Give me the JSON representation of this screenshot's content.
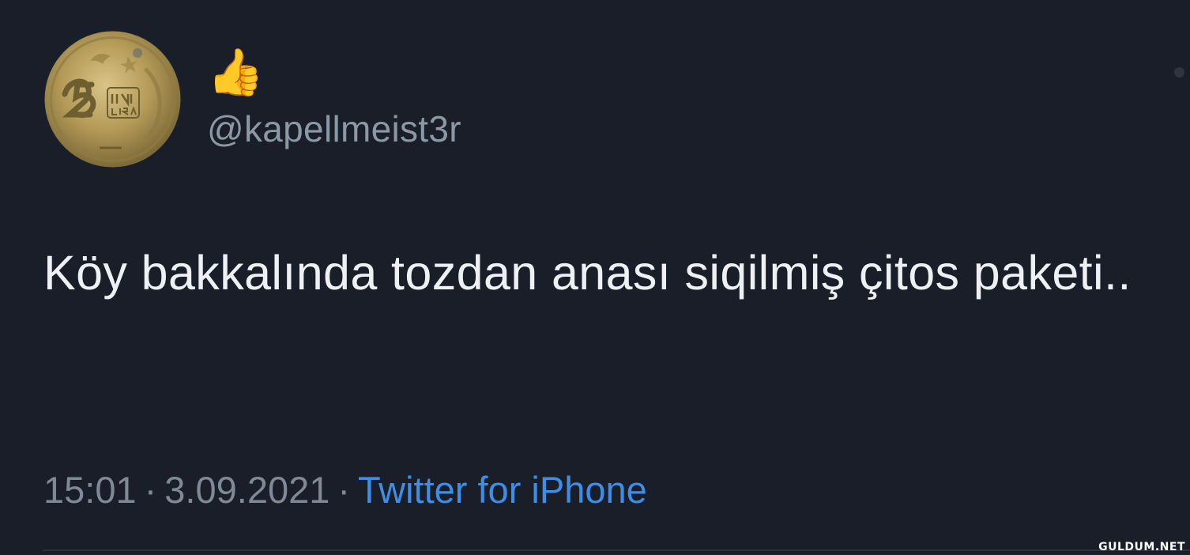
{
  "tweet": {
    "display_name": "👍",
    "handle": "@kapellmeist3r",
    "text": "Köy bakkalında tozdan anası siqilmiş çitos paketi..",
    "time": "15:01",
    "separator": "·",
    "date": "3.09.2021",
    "source": "Twitter for iPhone",
    "avatar_icon": "coin-avatar-icon"
  },
  "watermark": "GULDUM.NET",
  "colors": {
    "background": "#191e29",
    "text": "#eef0f3",
    "secondary": "#8b98a5",
    "link": "#3d8ee6"
  }
}
